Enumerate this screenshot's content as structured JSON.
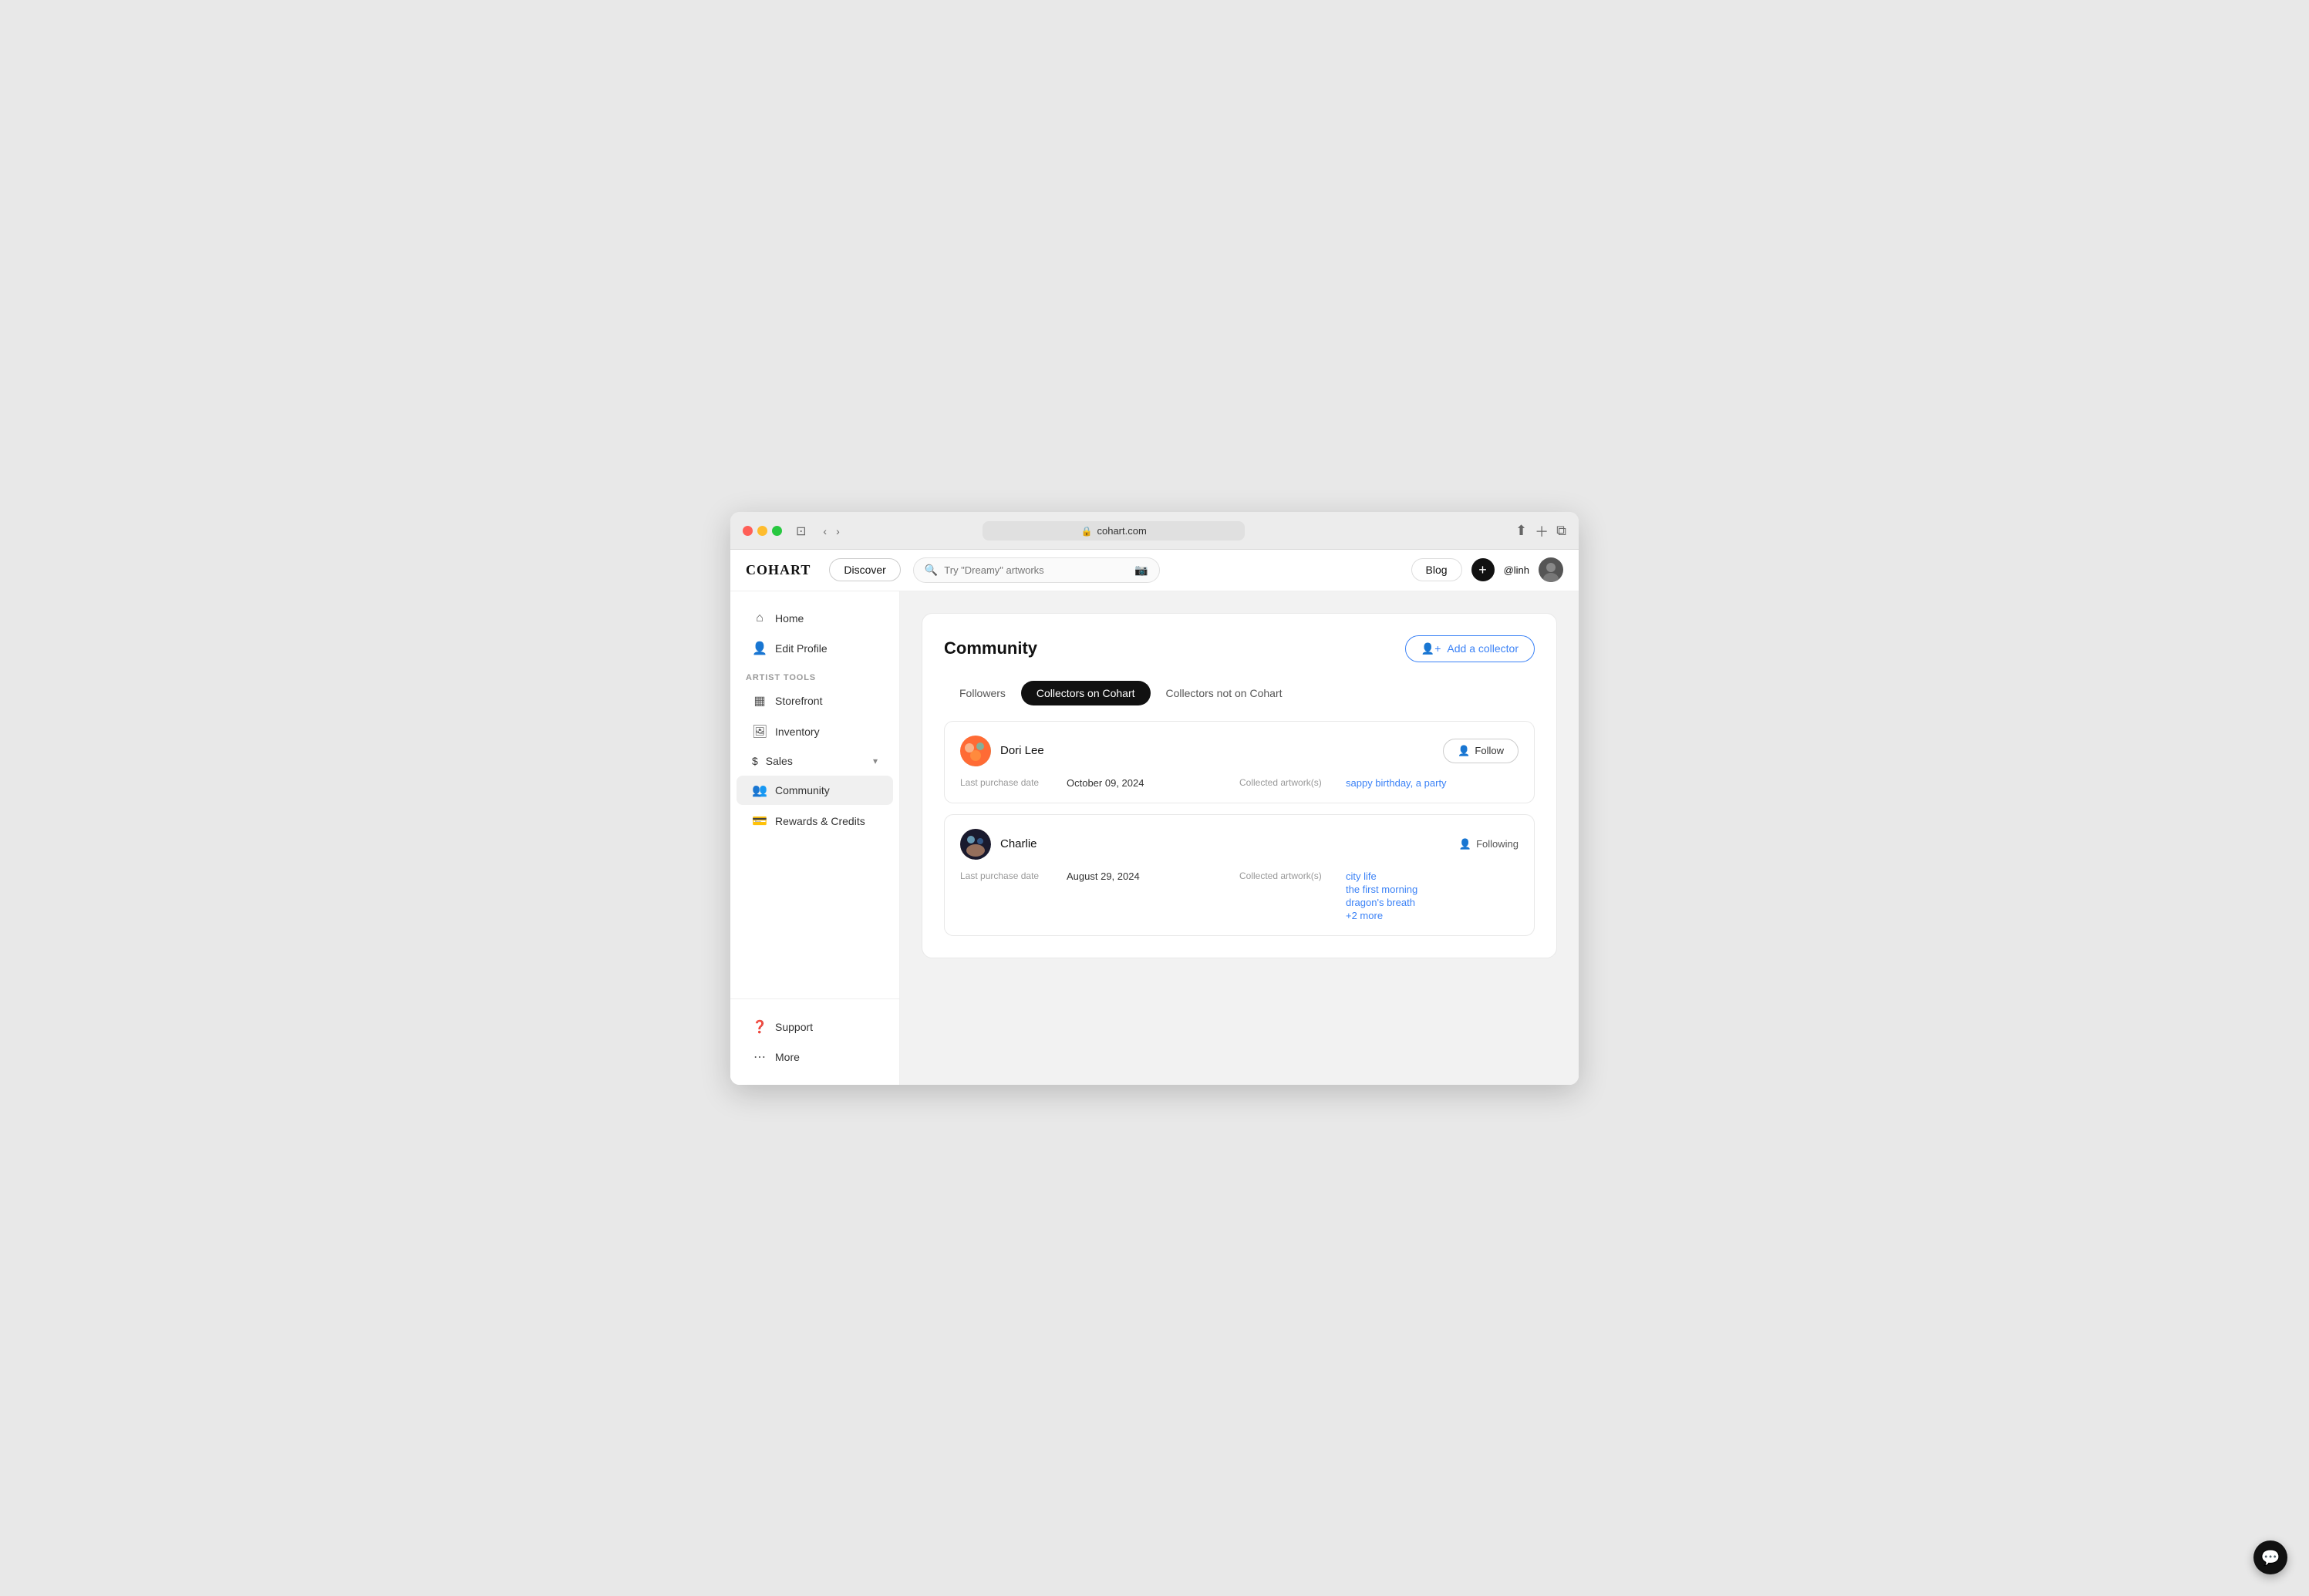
{
  "browser": {
    "url": "cohart.com",
    "lock_icon": "🔒"
  },
  "topnav": {
    "logo": "COHART",
    "discover_label": "Discover",
    "search_placeholder": "Try \"Dreamy\" artworks",
    "blog_label": "Blog",
    "plus_icon": "+",
    "username": "@linh"
  },
  "sidebar": {
    "home_label": "Home",
    "edit_profile_label": "Edit Profile",
    "artist_tools_label": "ARTIST TOOLS",
    "storefront_label": "Storefront",
    "inventory_label": "Inventory",
    "sales_label": "Sales",
    "community_label": "Community",
    "rewards_label": "Rewards & Credits",
    "support_label": "Support",
    "more_label": "More"
  },
  "main": {
    "page_title": "Community",
    "add_collector_label": "Add a collector",
    "tabs": [
      {
        "label": "Followers",
        "active": false
      },
      {
        "label": "Collectors on Cohart",
        "active": true
      },
      {
        "label": "Collectors not on Cohart",
        "active": false
      }
    ],
    "collectors": [
      {
        "name": "Dori Lee",
        "last_purchase_label": "Last purchase date",
        "last_purchase_date": "October 09, 2024",
        "collected_label": "Collected artwork(s)",
        "artworks": [
          "sappy birthday, a party"
        ],
        "more_count": null,
        "action_label": "Follow",
        "action_type": "follow"
      },
      {
        "name": "Charlie",
        "last_purchase_label": "Last purchase date",
        "last_purchase_date": "August 29, 2024",
        "collected_label": "Collected artwork(s)",
        "artworks": [
          "city life",
          "the first morning",
          "dragon's breath"
        ],
        "more_count": "+2 more",
        "action_label": "Following",
        "action_type": "following"
      }
    ]
  }
}
